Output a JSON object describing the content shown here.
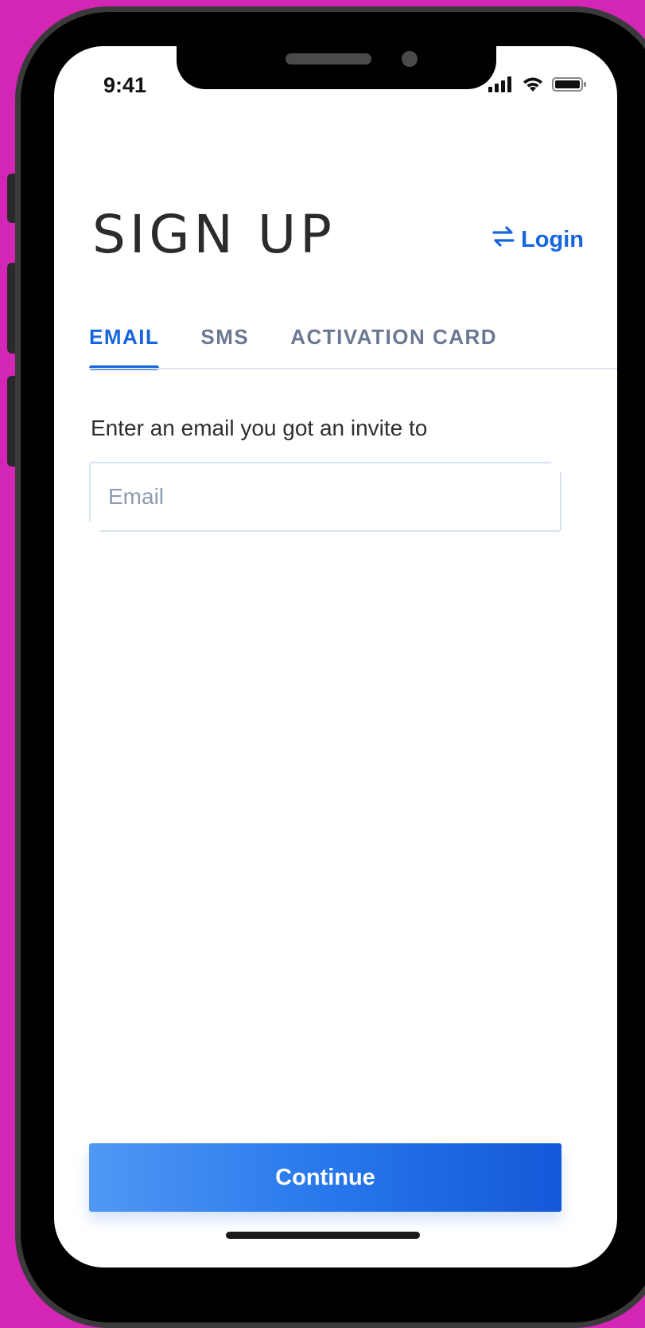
{
  "status_bar": {
    "time": "9:41",
    "icons": [
      "signal-icon",
      "wifi-icon",
      "battery-icon"
    ]
  },
  "header": {
    "title": "SIGN UP",
    "login_label": "Login",
    "login_icon": "swap-arrows-icon"
  },
  "tabs": [
    {
      "label": "EMAIL",
      "active": true
    },
    {
      "label": "SMS",
      "active": false
    },
    {
      "label": "ACTIVATION CARD",
      "active": false
    }
  ],
  "form": {
    "label": "Enter an email you got an invite to",
    "email_placeholder": "Email",
    "email_value": ""
  },
  "continue_label": "Continue",
  "colors": {
    "accent": "#1565e0",
    "background": "#d426b4",
    "muted_tab": "#6a7892"
  }
}
